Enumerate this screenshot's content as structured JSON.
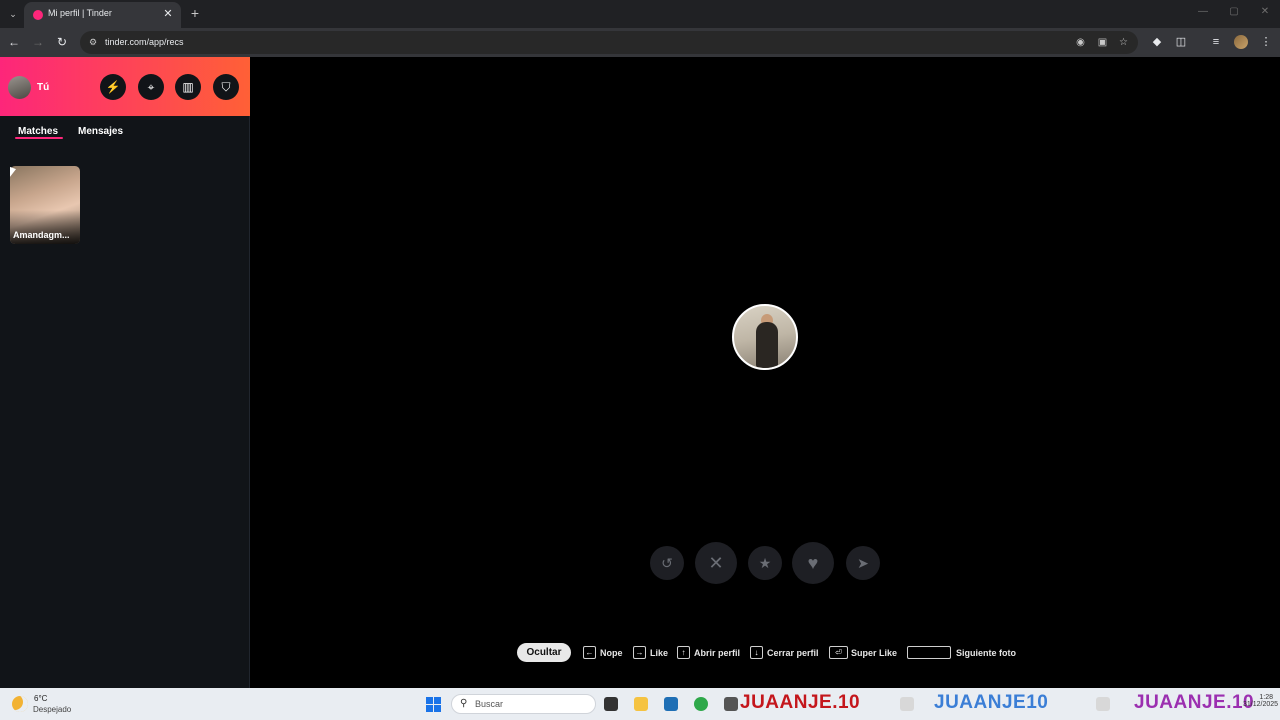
{
  "browser": {
    "tab_menu_glyph": "⌄",
    "tab_title": "Mi perfil | Tinder",
    "tab_close_glyph": "✕",
    "new_tab_glyph": "+",
    "url": "tinder.com/app/recs",
    "window_controls": [
      "—",
      "▢",
      "✕"
    ]
  },
  "sidebar": {
    "user_label": "Tú",
    "tabs": [
      {
        "label": "Matches",
        "active": true
      },
      {
        "label": "Mensajes",
        "active": false
      }
    ],
    "matches": [
      {
        "name": "Amandagm..."
      }
    ]
  },
  "header_buttons": [
    {
      "icon": "boost-bolt-icon",
      "glyph": "⚡"
    },
    {
      "icon": "explore-compass-icon",
      "glyph": "⌖"
    },
    {
      "icon": "briefcase-icon",
      "glyph": "▥"
    },
    {
      "icon": "shield-icon",
      "glyph": "⛉"
    }
  ],
  "actions": [
    {
      "name": "rewind",
      "glyph": "↺"
    },
    {
      "name": "nope",
      "glyph": "✕"
    },
    {
      "name": "super-like",
      "glyph": "★"
    },
    {
      "name": "like",
      "glyph": "♥"
    },
    {
      "name": "boost",
      "glyph": "➤"
    }
  ],
  "shortcut_hints": {
    "hide_label": "Ocultar",
    "items": [
      {
        "key": "←",
        "label": "Nope"
      },
      {
        "key": "→",
        "label": "Like"
      },
      {
        "key": "↑",
        "label": "Abrir perfil"
      },
      {
        "key": "↓",
        "label": "Cerrar perfil"
      },
      {
        "key": "⏎",
        "label": "Super Like"
      },
      {
        "key": "",
        "label": "Siguiente foto"
      }
    ]
  },
  "taskbar": {
    "weather_temp": "6°C",
    "weather_desc": "Despejado",
    "search_placeholder": "Buscar",
    "watermarks": [
      "JUAANJE.10",
      "JUAANJE10",
      "JUAANJE.10"
    ],
    "clock_time": "1:28",
    "clock_date": "31/12/2025"
  },
  "colors": {
    "brand_gradient_start": "#fd267a",
    "brand_gradient_end": "#ff6036",
    "sidebar_bg": "#111418"
  }
}
